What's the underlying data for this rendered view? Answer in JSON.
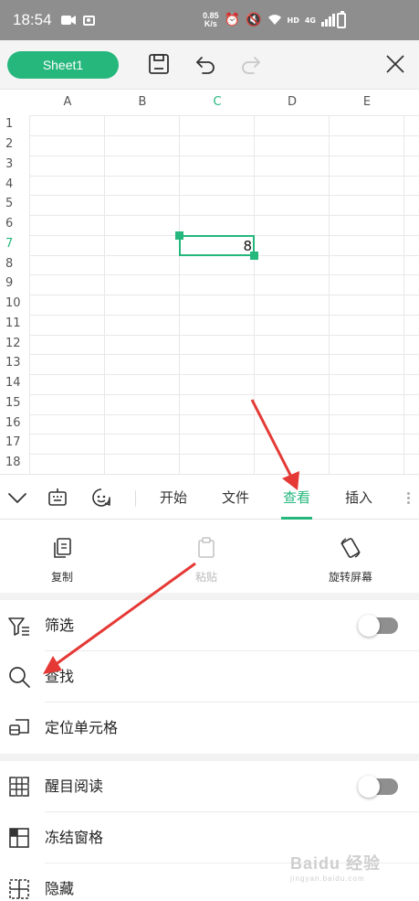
{
  "status_bar": {
    "time": "18:54",
    "net_speed_value": "0.85",
    "net_speed_unit": "K/s",
    "hd_label": "HD",
    "network_type": "4G"
  },
  "toolbar": {
    "sheet_name": "Sheet1"
  },
  "grid": {
    "columns": [
      "A",
      "B",
      "C",
      "D",
      "E"
    ],
    "rows": [
      "1",
      "2",
      "3",
      "4",
      "5",
      "6",
      "7",
      "8",
      "9",
      "10",
      "11",
      "12",
      "13",
      "14",
      "15",
      "16",
      "17",
      "18"
    ],
    "active_column": "C",
    "active_row": "7",
    "selected_cell_value": "8"
  },
  "tabbar": {
    "tabs": [
      "开始",
      "文件",
      "查看",
      "插入"
    ],
    "active_tab": "查看"
  },
  "quick_actions": {
    "copy": "复制",
    "paste": "粘贴",
    "rotate": "旋转屏幕"
  },
  "menu": {
    "filter": "筛选",
    "find": "查找",
    "goto_cell": "定位单元格",
    "reading_mode": "醒目阅读",
    "freeze_panes": "冻结窗格",
    "hide": "隐藏"
  },
  "colors": {
    "accent": "#25b77c",
    "annotation_arrow": "#e53935"
  }
}
